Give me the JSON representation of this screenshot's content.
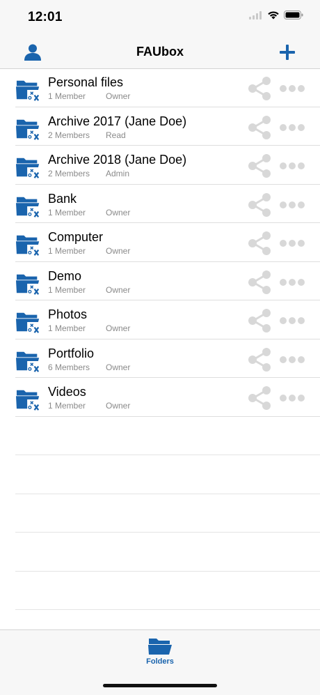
{
  "status": {
    "time": "12:01"
  },
  "nav": {
    "title": "FAUbox",
    "left_icon": "person-icon",
    "right_icon": "plus-icon",
    "accent": "#1a64ad"
  },
  "folders": [
    {
      "name": "Personal files",
      "members": "1 Member",
      "role": "Owner"
    },
    {
      "name": "Archive 2017 (Jane Doe)",
      "members": "2 Members",
      "role": "Read"
    },
    {
      "name": "Archive 2018 (Jane Doe)",
      "members": "2 Members",
      "role": "Admin"
    },
    {
      "name": "Bank",
      "members": "1 Member",
      "role": "Owner"
    },
    {
      "name": "Computer",
      "members": "1 Member",
      "role": "Owner"
    },
    {
      "name": "Demo",
      "members": "1 Member",
      "role": "Owner"
    },
    {
      "name": "Photos",
      "members": "1 Member",
      "role": "Owner"
    },
    {
      "name": "Portfolio",
      "members": "6 Members",
      "role": "Owner"
    },
    {
      "name": "Videos",
      "members": "1 Member",
      "role": "Owner"
    }
  ],
  "tabbar": {
    "folders_label": "Folders"
  },
  "colors": {
    "accent": "#1a64ad",
    "icon_gray": "#d8d8d8",
    "subtext": "#8a8a8a"
  }
}
